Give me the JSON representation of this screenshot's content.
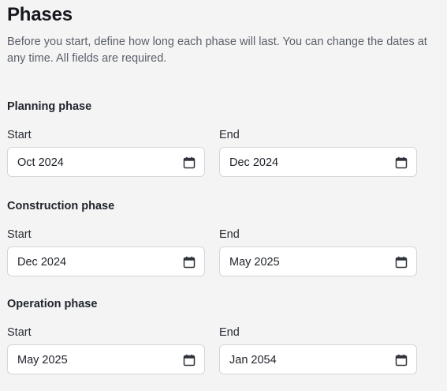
{
  "header": {
    "title": "Phases",
    "description": "Before you start, define how long each phase will last. You can change the dates at any time. All fields are required."
  },
  "phases": [
    {
      "name": "Planning phase",
      "start_label": "Start",
      "start_value": "Oct 2024",
      "end_label": "End",
      "end_value": "Dec 2024"
    },
    {
      "name": "Construction phase",
      "start_label": "Start",
      "start_value": "Dec 2024",
      "end_label": "End",
      "end_value": "May 2025"
    },
    {
      "name": "Operation phase",
      "start_label": "Start",
      "start_value": "May 2025",
      "end_label": "End",
      "end_value": "Jan 2054"
    }
  ],
  "icons": {
    "date_picker": "calendar-icon"
  },
  "colors": {
    "background": "#f4f4f4",
    "field_border": "#d4d6da",
    "text_primary": "#1b1f2a",
    "text_secondary": "#5b606b"
  }
}
